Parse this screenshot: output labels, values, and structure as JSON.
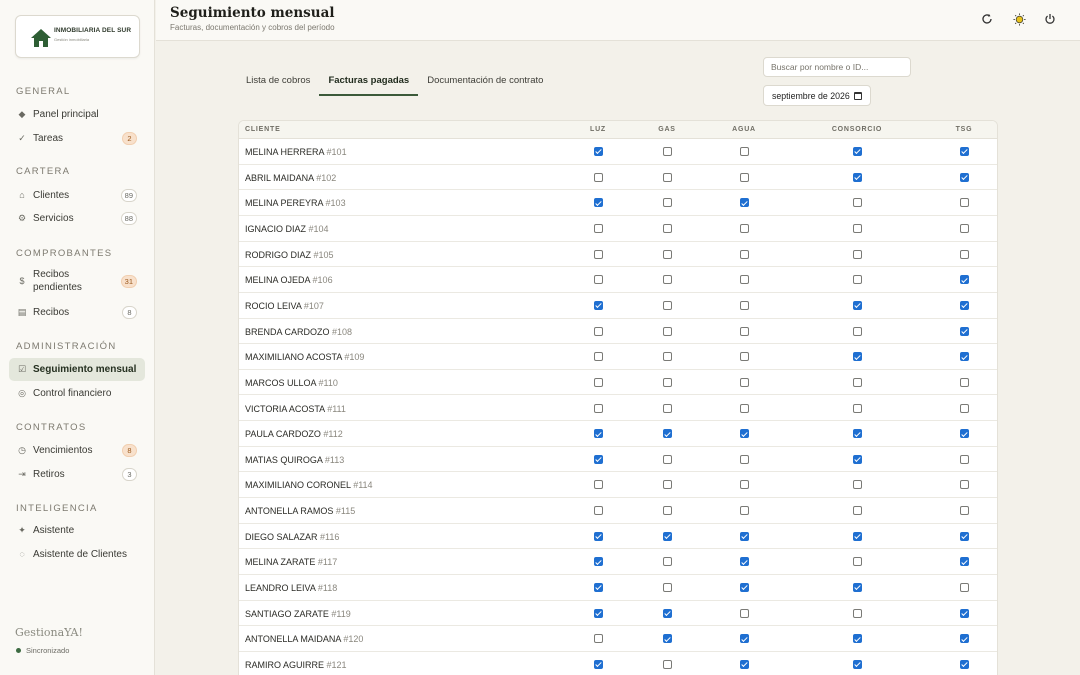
{
  "sidebar": {
    "logo": {
      "title": "INMOBILIARIA DEL SUR",
      "subtitle": "Gestión inmobiliaria"
    },
    "sections": [
      {
        "title": "GENERAL",
        "items": [
          {
            "label": "Panel principal",
            "icon": "diamond-icon"
          },
          {
            "label": "Tareas",
            "icon": "check-icon",
            "badge": "2",
            "badge_style": "warn"
          }
        ]
      },
      {
        "title": "CARTERA",
        "items": [
          {
            "label": "Clientes",
            "icon": "home-icon",
            "badge": "89",
            "badge_style": "neutral"
          },
          {
            "label": "Servicios",
            "icon": "gear-icon",
            "badge": "88",
            "badge_style": "neutral"
          }
        ]
      },
      {
        "title": "COMPROBANTES",
        "items": [
          {
            "label": "Recibos pendientes",
            "icon": "dollar-icon",
            "badge": "31",
            "badge_style": "warn"
          },
          {
            "label": "Recibos",
            "icon": "receipt-icon",
            "badge": "8",
            "badge_style": "neutral"
          }
        ]
      },
      {
        "title": "ADMINISTRACIÓN",
        "items": [
          {
            "label": "Seguimiento mensual",
            "icon": "checkbox-icon",
            "active": true
          },
          {
            "label": "Control financiero",
            "icon": "coin-icon"
          }
        ]
      },
      {
        "title": "CONTRATOS",
        "items": [
          {
            "label": "Vencimientos",
            "icon": "clock-icon",
            "badge": "8",
            "badge_style": "warn"
          },
          {
            "label": "Retiros",
            "icon": "exit-icon",
            "badge": "3",
            "badge_style": "neutral"
          }
        ]
      },
      {
        "title": "INTELIGENCIA",
        "items": [
          {
            "label": "Asistente",
            "icon": "sparkle-icon"
          },
          {
            "label": "Asistente de Clientes",
            "icon": "chat-icon"
          }
        ]
      }
    ],
    "brand": "GestionaYA!",
    "sync_status": "Sincronizado"
  },
  "header": {
    "title": "Seguimiento mensual",
    "subtitle": "Facturas, documentación y cobros del período"
  },
  "tabs": [
    "Lista de cobros",
    "Facturas pagadas",
    "Documentación de contrato"
  ],
  "active_tab": 1,
  "search": {
    "placeholder": "Buscar por nombre o ID..."
  },
  "month_picker": {
    "value": "septiembre de 2026"
  },
  "table": {
    "columns": [
      "CLIENTE",
      "LUZ",
      "GAS",
      "AGUA",
      "CONSORCIO",
      "TSG"
    ],
    "rows": [
      {
        "name": "MELINA HERRERA",
        "id": "#101",
        "checks": [
          true,
          false,
          false,
          true,
          true
        ]
      },
      {
        "name": "ABRIL MAIDANA",
        "id": "#102",
        "checks": [
          false,
          false,
          false,
          true,
          true
        ]
      },
      {
        "name": "MELINA PEREYRA",
        "id": "#103",
        "checks": [
          true,
          false,
          true,
          false,
          false
        ]
      },
      {
        "name": "IGNACIO DIAZ",
        "id": "#104",
        "checks": [
          false,
          false,
          false,
          false,
          false
        ]
      },
      {
        "name": "RODRIGO DIAZ",
        "id": "#105",
        "checks": [
          false,
          false,
          false,
          false,
          false
        ]
      },
      {
        "name": "MELINA OJEDA",
        "id": "#106",
        "checks": [
          false,
          false,
          false,
          false,
          true
        ]
      },
      {
        "name": "ROCIO LEIVA",
        "id": "#107",
        "checks": [
          true,
          false,
          false,
          true,
          true
        ]
      },
      {
        "name": "BRENDA CARDOZO",
        "id": "#108",
        "checks": [
          false,
          false,
          false,
          false,
          true
        ]
      },
      {
        "name": "MAXIMILIANO ACOSTA",
        "id": "#109",
        "checks": [
          false,
          false,
          false,
          true,
          true
        ]
      },
      {
        "name": "MARCOS ULLOA",
        "id": "#110",
        "checks": [
          false,
          false,
          false,
          false,
          false
        ]
      },
      {
        "name": "VICTORIA ACOSTA",
        "id": "#111",
        "checks": [
          false,
          false,
          false,
          false,
          false
        ]
      },
      {
        "name": "PAULA CARDOZO",
        "id": "#112",
        "checks": [
          true,
          true,
          true,
          true,
          true
        ]
      },
      {
        "name": "MATIAS QUIROGA",
        "id": "#113",
        "checks": [
          true,
          false,
          false,
          true,
          false
        ]
      },
      {
        "name": "MAXIMILIANO CORONEL",
        "id": "#114",
        "checks": [
          false,
          false,
          false,
          false,
          false
        ]
      },
      {
        "name": "ANTONELLA RAMOS",
        "id": "#115",
        "checks": [
          false,
          false,
          false,
          false,
          false
        ]
      },
      {
        "name": "DIEGO SALAZAR",
        "id": "#116",
        "checks": [
          true,
          true,
          true,
          true,
          true
        ]
      },
      {
        "name": "MELINA ZARATE",
        "id": "#117",
        "checks": [
          true,
          false,
          true,
          false,
          true
        ]
      },
      {
        "name": "LEANDRO LEIVA",
        "id": "#118",
        "checks": [
          true,
          false,
          true,
          true,
          false
        ]
      },
      {
        "name": "SANTIAGO ZARATE",
        "id": "#119",
        "checks": [
          true,
          true,
          false,
          false,
          true
        ]
      },
      {
        "name": "ANTONELLA MAIDANA",
        "id": "#120",
        "checks": [
          false,
          true,
          true,
          true,
          true
        ]
      },
      {
        "name": "RAMIRO AGUIRRE",
        "id": "#121",
        "checks": [
          true,
          false,
          true,
          true,
          true
        ]
      }
    ]
  },
  "colors": {
    "accent": "#3b5a3a",
    "checkbox": "#1f6fd1",
    "background": "#f3f1ea"
  }
}
